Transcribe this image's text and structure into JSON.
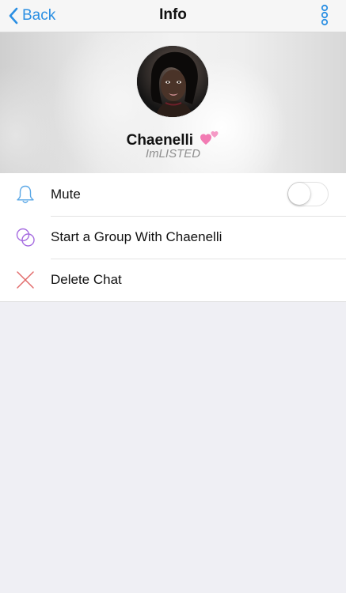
{
  "nav": {
    "back_label": "Back",
    "title": "Info",
    "back_icon": "chevron-left-icon",
    "more_icon": "vertical-dots-icon"
  },
  "profile": {
    "name": "Chaenelli",
    "emoji": "💕",
    "status": "ImLISTED"
  },
  "actions": {
    "mute": {
      "label": "Mute",
      "icon": "bell-icon",
      "toggle_on": false
    },
    "start_group": {
      "label": "Start a Group With Chaenelli",
      "icon": "group-circles-icon"
    },
    "delete_chat": {
      "label": "Delete Chat",
      "icon": "x-icon"
    }
  },
  "colors": {
    "accent": "#2b8fe3",
    "mute_icon": "#5aa7e6",
    "group_icon": "#a56be0",
    "delete_icon": "#e26b6b",
    "background": "#efeff4"
  }
}
